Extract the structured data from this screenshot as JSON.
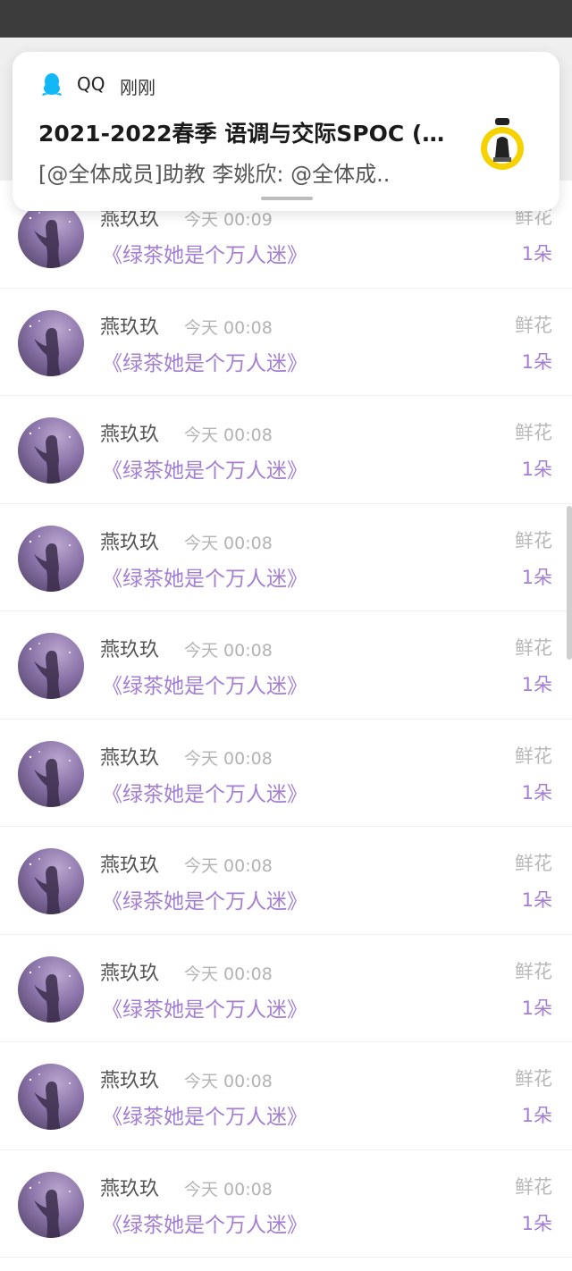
{
  "notification": {
    "app_name": "QQ",
    "time": "刚刚",
    "title": "2021-2022春季 语调与交际SPOC (…",
    "body": "[@全体成员]助教 李姚欣: @全体成.."
  },
  "list": {
    "rows": [
      {
        "user": "燕玖玖",
        "time": "今天 00:09",
        "gift_type": "鲜花",
        "book": "《绿茶她是个万人迷》",
        "count": "1朵"
      },
      {
        "user": "燕玖玖",
        "time": "今天 00:08",
        "gift_type": "鲜花",
        "book": "《绿茶她是个万人迷》",
        "count": "1朵"
      },
      {
        "user": "燕玖玖",
        "time": "今天 00:08",
        "gift_type": "鲜花",
        "book": "《绿茶她是个万人迷》",
        "count": "1朵"
      },
      {
        "user": "燕玖玖",
        "time": "今天 00:08",
        "gift_type": "鲜花",
        "book": "《绿茶她是个万人迷》",
        "count": "1朵"
      },
      {
        "user": "燕玖玖",
        "time": "今天 00:08",
        "gift_type": "鲜花",
        "book": "《绿茶她是个万人迷》",
        "count": "1朵"
      },
      {
        "user": "燕玖玖",
        "time": "今天 00:08",
        "gift_type": "鲜花",
        "book": "《绿茶她是个万人迷》",
        "count": "1朵"
      },
      {
        "user": "燕玖玖",
        "time": "今天 00:08",
        "gift_type": "鲜花",
        "book": "《绿茶她是个万人迷》",
        "count": "1朵"
      },
      {
        "user": "燕玖玖",
        "time": "今天 00:08",
        "gift_type": "鲜花",
        "book": "《绿茶她是个万人迷》",
        "count": "1朵"
      },
      {
        "user": "燕玖玖",
        "time": "今天 00:08",
        "gift_type": "鲜花",
        "book": "《绿茶她是个万人迷》",
        "count": "1朵"
      },
      {
        "user": "燕玖玖",
        "time": "今天 00:08",
        "gift_type": "鲜花",
        "book": "《绿茶她是个万人迷》",
        "count": "1朵"
      }
    ]
  },
  "colors": {
    "accent_purple": "#a37ed1",
    "status_bar": "#3c3c3c",
    "qq_blue": "#12b7f5"
  }
}
